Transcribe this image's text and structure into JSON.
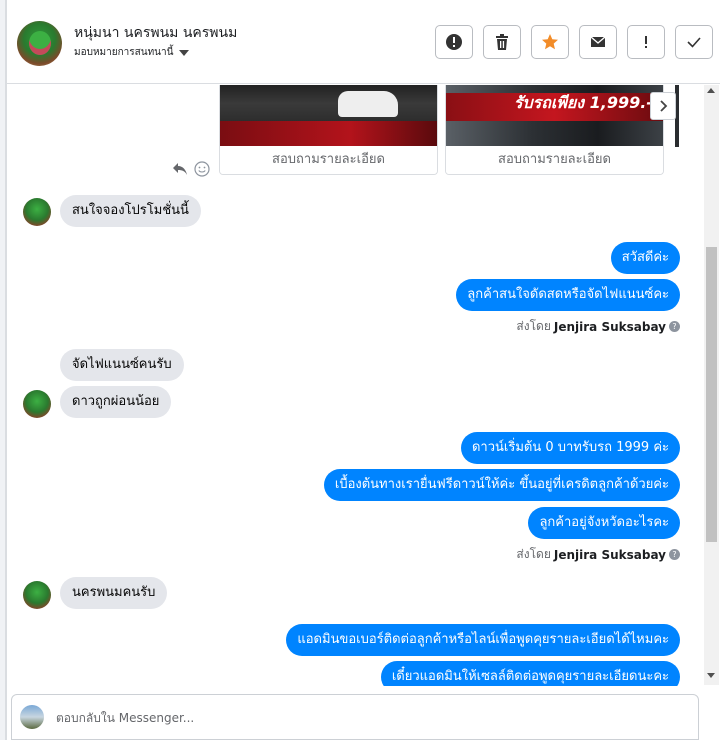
{
  "header": {
    "name": "หนุ่มนา นครพนม นครพนม",
    "assign_label": "มอบหมายการสนทนานี้"
  },
  "actions": [
    {
      "name": "report-button",
      "icon": "alert-circle-icon"
    },
    {
      "name": "delete-button",
      "icon": "trash-icon"
    },
    {
      "name": "star-button",
      "icon": "star-icon"
    },
    {
      "name": "mark-unread-button",
      "icon": "envelope-icon"
    },
    {
      "name": "mark-spam-button",
      "icon": "exclamation-icon"
    },
    {
      "name": "mark-done-button",
      "icon": "check-icon"
    }
  ],
  "cards": [
    {
      "title": "สอบถามรายละเอียด"
    },
    {
      "title": "สอบถามรายละเอียด",
      "promo": "รับรถเพียง 1,999.-"
    }
  ],
  "messages": [
    {
      "dir": "in",
      "text": "สนใจจองโปรโมชั่นนี้"
    },
    {
      "dir": "out",
      "text": "สวัสดีค่ะ"
    },
    {
      "dir": "out",
      "text": "ลูกค้าสนใจดัดสดหรือจัดไฟแนนซ์คะ"
    },
    {
      "dir": "in",
      "text": "จัดไฟแนนซ์คนรับ"
    },
    {
      "dir": "in",
      "text": "ดาวถูกผ่อนน้อย"
    },
    {
      "dir": "out",
      "text": "ดาวน์เริ่มต้น 0 บาทรับรถ 1999 ค่ะ"
    },
    {
      "dir": "out",
      "text": "เบื้องต้นทางเรายื่นฟรีดาวน์ให้ค่ะ ขึ้นอยู่ที่เครดิตลูกค้าด้วยค่ะ"
    },
    {
      "dir": "out",
      "text": "ลูกค้าอยู่จังหวัดอะไรคะ"
    },
    {
      "dir": "in",
      "text": "นครพนมคนรับ"
    },
    {
      "dir": "out",
      "text": "แอดมินขอเบอร์ติดต่อลูกค้าหรือไลน์เพื่อพูดคุยรายละเอียดได้ไหมคะ"
    },
    {
      "dir": "out",
      "text": "เดี๋ยวแอดมินให้เซลล์ติดต่อพูดคุยรายละเอียดนะคะ"
    }
  ],
  "sent_by": {
    "prefix": "ส่งโดย",
    "agent": "Jenjira Suksabay"
  },
  "composer": {
    "placeholder": "ตอบกลับใน Messenger..."
  }
}
